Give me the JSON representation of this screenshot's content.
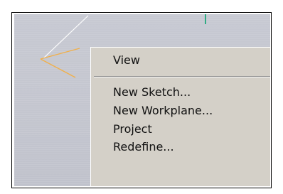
{
  "viewport": {
    "background": "#c6c8d1",
    "sketch_line_color": "#f1b04a",
    "workplane_line_color": "#0aa36f"
  },
  "context_menu": {
    "background": "#d4d0c8",
    "items": [
      {
        "label": "View",
        "has_submenu": true
      },
      {
        "label": "New Sketch..."
      },
      {
        "label": "New Workplane..."
      },
      {
        "label": "Project"
      },
      {
        "label": "Redefine..."
      }
    ]
  }
}
